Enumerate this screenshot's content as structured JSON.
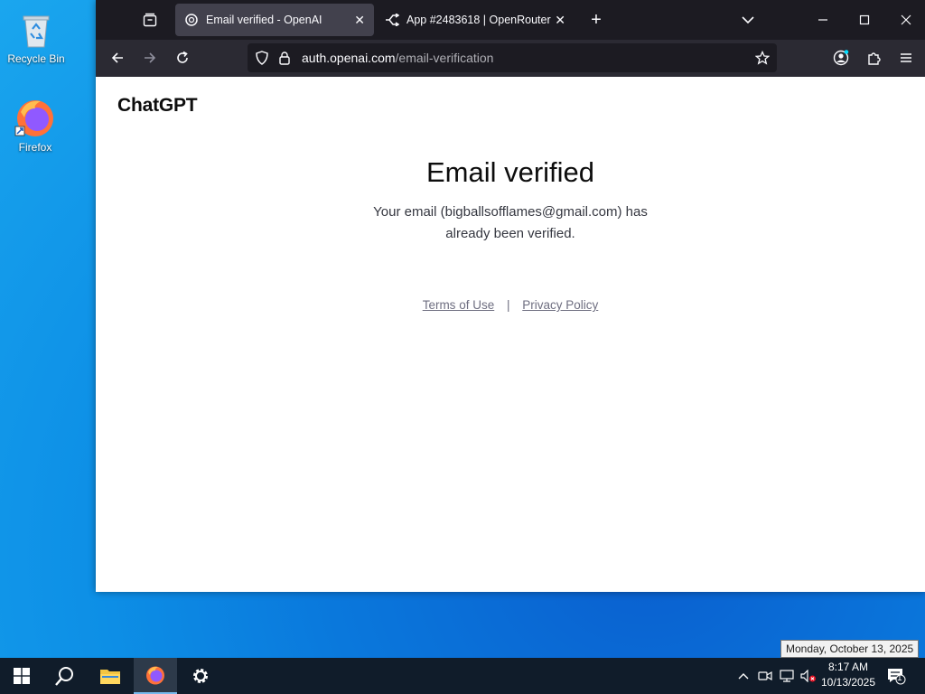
{
  "desktop": {
    "icons": [
      {
        "label": "Recycle Bin",
        "icon": "recycle-bin-icon"
      },
      {
        "label": "Firefox",
        "icon": "firefox-icon"
      }
    ]
  },
  "browser": {
    "tabs": [
      {
        "title": "Email verified - OpenAI",
        "active": true,
        "icon": "openai-icon"
      },
      {
        "title": "App #2483618 | OpenRouter",
        "active": false,
        "icon": "openrouter-icon"
      }
    ],
    "url": {
      "domain": "auth.openai.com",
      "path": "/email-verification"
    }
  },
  "page": {
    "logo": "ChatGPT",
    "heading": "Email verified",
    "description": "Your email (bigballsofflames@gmail.com) has already been verified.",
    "footer": {
      "terms": "Terms of Use",
      "separator": "|",
      "privacy": "Privacy Policy"
    }
  },
  "taskbar": {
    "time": "8:17 AM",
    "date": "10/13/2025",
    "tooltip": "Monday, October 13, 2025",
    "notification_count": "1"
  },
  "colors": {
    "tabbar_bg": "#1c1b22",
    "navbar_bg": "#2b2a33",
    "active_tab_bg": "#42414d",
    "taskbar_bg": "#101c2a"
  }
}
